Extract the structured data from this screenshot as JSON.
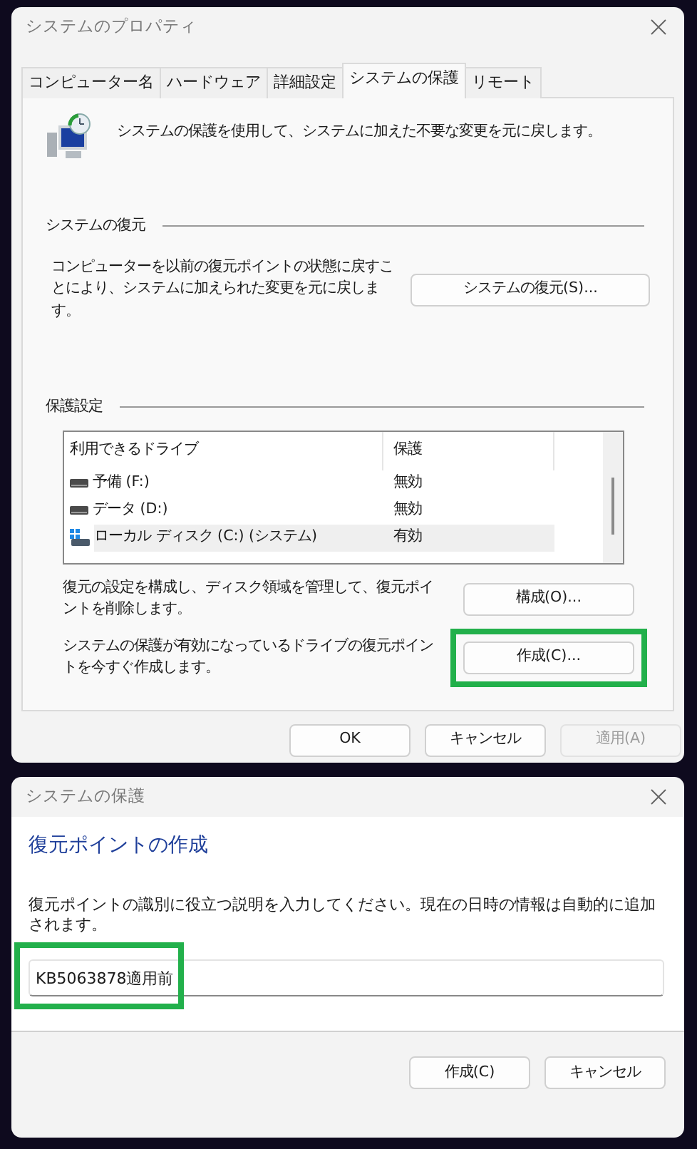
{
  "main_window": {
    "title": "システムのプロパティ",
    "tabs": [
      {
        "label": "コンピューター名",
        "selected": false
      },
      {
        "label": "ハードウェア",
        "selected": false
      },
      {
        "label": "詳細設定",
        "selected": false
      },
      {
        "label": "システムの保護",
        "selected": true
      },
      {
        "label": "リモート",
        "selected": false
      }
    ],
    "intro": "システムの保護を使用して、システムに加えた不要な変更を元に戻します。",
    "restore_section": {
      "heading": "システムの復元",
      "text": "コンピューターを以前の復元ポイントの状態に戻すことにより、システムに加えられた変更を元に戻します。",
      "button": "システムの復元(S)..."
    },
    "protection_section": {
      "heading": "保護設定",
      "table": {
        "columns": [
          "利用できるドライブ",
          "保護"
        ],
        "rows": [
          {
            "kind": "drive",
            "name": "予備 (F:)",
            "protection": "無効",
            "selected": false
          },
          {
            "kind": "drive",
            "name": "データ (D:)",
            "protection": "無効",
            "selected": false
          },
          {
            "kind": "system",
            "name": "ローカル ディスク (C:) (システム)",
            "protection": "有効",
            "selected": true
          }
        ]
      },
      "actions": [
        {
          "text": "復元の設定を構成し、ディスク領域を管理して、復元ポイントを削除します。",
          "button": "構成(O)...",
          "highlighted": false
        },
        {
          "text": "システムの保護が有効になっているドライブの復元ポイントを今すぐ作成します。",
          "button": "作成(C)...",
          "highlighted": true
        }
      ]
    },
    "buttons": [
      {
        "label": "OK",
        "disabled": false
      },
      {
        "label": "キャンセル",
        "disabled": false
      },
      {
        "label": "適用(A)",
        "disabled": true
      }
    ]
  },
  "create_dialog": {
    "title": "システムの保護",
    "heading": "復元ポイントの作成",
    "text": "復元ポイントの識別に役立つ説明を入力してください。現在の日時の情報は自動的に追加されます。",
    "input": {
      "value": "KB5063878適用前",
      "highlighted": true
    },
    "buttons": [
      {
        "label": "作成(C)",
        "disabled": false
      },
      {
        "label": "キャンセル",
        "disabled": false
      }
    ]
  }
}
